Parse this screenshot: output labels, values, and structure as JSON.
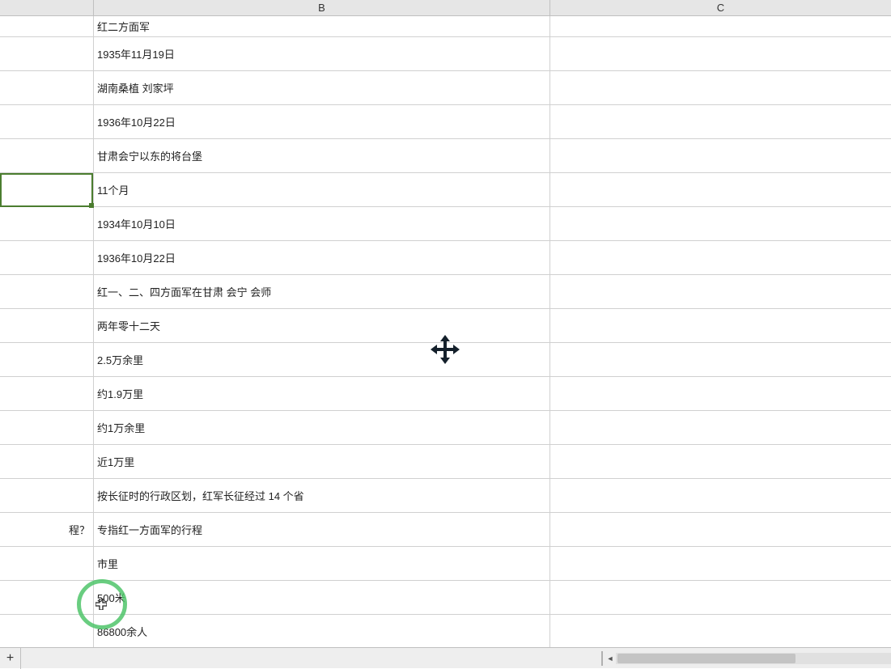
{
  "columns": {
    "B": "B",
    "C": "C"
  },
  "rows": [
    {
      "a": "",
      "b": "红二方面军"
    },
    {
      "a": "",
      "b": "1935年11月19日"
    },
    {
      "a": "",
      "b": "湖南桑植 刘家坪"
    },
    {
      "a": "",
      "b": "1936年10月22日"
    },
    {
      "a": "",
      "b": "甘肃会宁以东的将台堡"
    },
    {
      "a": "",
      "b": "11个月"
    },
    {
      "a": "",
      "b": "1934年10月10日"
    },
    {
      "a": "",
      "b": "1936年10月22日"
    },
    {
      "a": "",
      "b": "红一、二、四方面军在甘肃 会宁 会师"
    },
    {
      "a": "",
      "b": "两年零十二天"
    },
    {
      "a": "",
      "b": "2.5万余里"
    },
    {
      "a": "",
      "b": "约1.9万里"
    },
    {
      "a": "",
      "b": "约1万余里"
    },
    {
      "a": "",
      "b": "近1万里"
    },
    {
      "a": "",
      "b": "按长征时的行政区划，红军长征经过 14 个省"
    },
    {
      "a": "程？",
      "b": "专指红一方面军的行程"
    },
    {
      "a": "",
      "b": "市里"
    },
    {
      "a": "",
      "b": "500米"
    },
    {
      "a": "",
      "b": "86800余人"
    }
  ],
  "icons": {
    "add_sheet": "+",
    "scroll_left": "◄",
    "scroll_right": "►"
  }
}
